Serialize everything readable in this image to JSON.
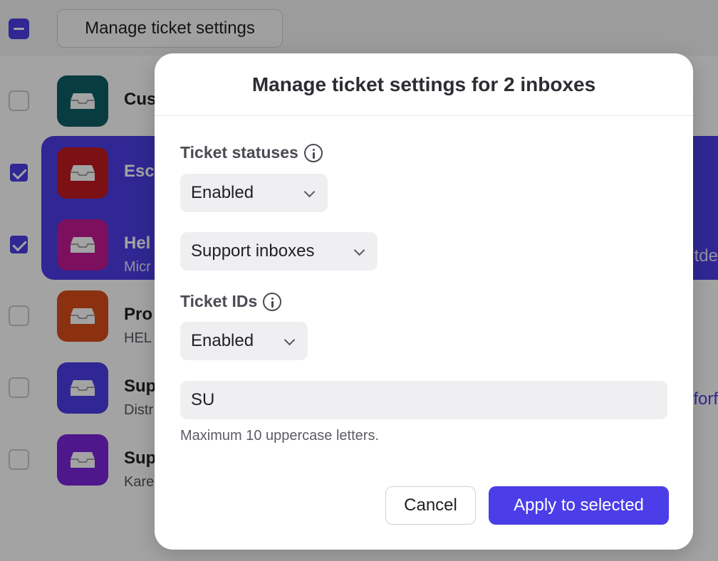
{
  "toolbar": {
    "manage_label": "Manage ticket settings"
  },
  "inboxes": [
    {
      "name": "Cus",
      "sub": "",
      "tail": "",
      "color": "#0e5e67",
      "checked": false
    },
    {
      "name": "Esc",
      "sub": "",
      "tail": "",
      "color": "#c01a22",
      "checked": true
    },
    {
      "name": "Hel",
      "sub": "Micr",
      "tail": "itde",
      "color": "#c21a95",
      "checked": true
    },
    {
      "name": "Pro",
      "sub": "HEL",
      "tail": "",
      "color": "#d94d18",
      "checked": false
    },
    {
      "name": "Sup",
      "sub": "Distr",
      "tail": "forf",
      "color": "#4b3de8",
      "checked": false
    },
    {
      "name": "Sup",
      "sub": "Kare",
      "tail": "",
      "color": "#7b25d9",
      "checked": false
    }
  ],
  "modal": {
    "title": "Manage ticket settings for 2 inboxes",
    "ticket_statuses_label": "Ticket statuses",
    "statuses_value": "Enabled",
    "scope_value": "Support inboxes",
    "ticket_ids_label": "Ticket IDs",
    "ids_value": "Enabled",
    "prefix_value": "SU",
    "prefix_hint": "Maximum 10 uppercase letters.",
    "cancel_label": "Cancel",
    "apply_label": "Apply to selected"
  }
}
